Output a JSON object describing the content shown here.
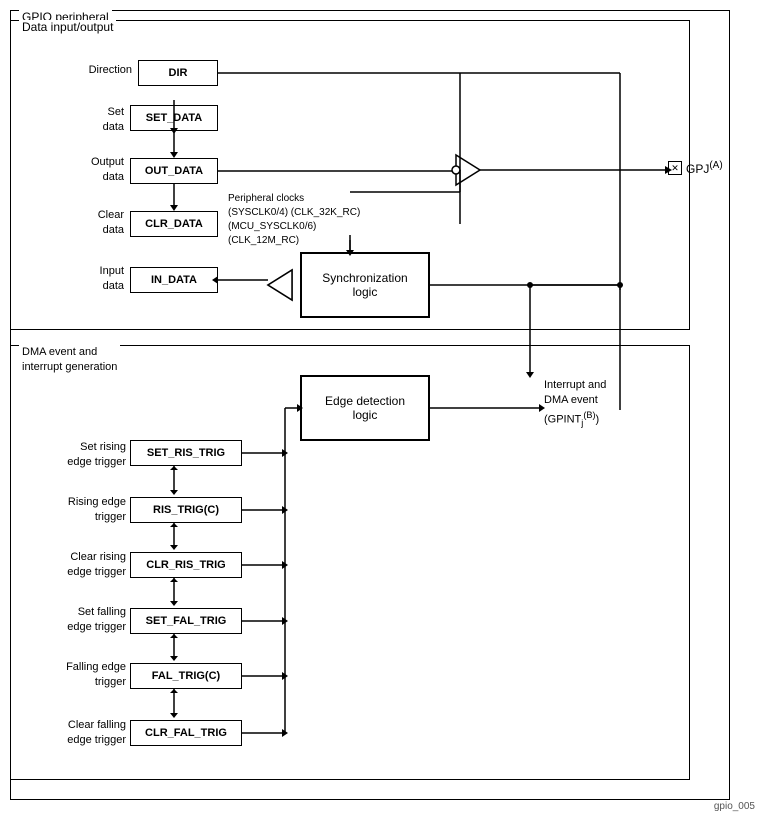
{
  "title": "GPIO peripheral",
  "data_io_title": "Data input/output",
  "dma_title": "DMA event and\ninterrupt generation",
  "registers": {
    "dir": "DIR",
    "set_data": "SET_DATA",
    "out_data": "OUT_DATA",
    "clr_data": "CLR_DATA",
    "in_data": "IN_DATA",
    "set_ris_trig": "SET_RIS_TRIG",
    "ris_trig": "RIS_TRIG(C)",
    "clr_ris_trig": "CLR_RIS_TRIG",
    "set_fal_trig": "SET_FAL_TRIG",
    "fal_trig": "FAL_TRIG(C)",
    "clr_fal_trig": "CLR_FAL_TRIG"
  },
  "labels": {
    "direction": "Direction",
    "set_data": "Set\ndata",
    "output_data": "Output\ndata",
    "clear_data": "Clear\ndata",
    "input_data": "Input\ndata",
    "set_rising": "Set rising\nedge trigger",
    "rising_edge": "Rising edge\ntrigger",
    "clear_rising": "Clear rising\nedge trigger",
    "set_falling": "Set falling\nedge trigger",
    "falling_edge": "Falling edge\ntrigger",
    "clear_falling": "Clear falling\nedge trigger",
    "peripheral_clocks": "Peripheral clocks\n(SYSCLK0/4) (CLK_32K_RC)\n(MCU_SYSCLK0/6) (CLK_12M_RC)",
    "sync_logic": "Synchronization\nlogic",
    "edge_logic": "Edge detection\nlogic",
    "gpj": "GPJ(A)",
    "interrupt": "Interrupt and\nDMA event\n(GPINTⱼ(B))",
    "gpint_superscript": "(B)"
  },
  "file_id": "gpio_005"
}
